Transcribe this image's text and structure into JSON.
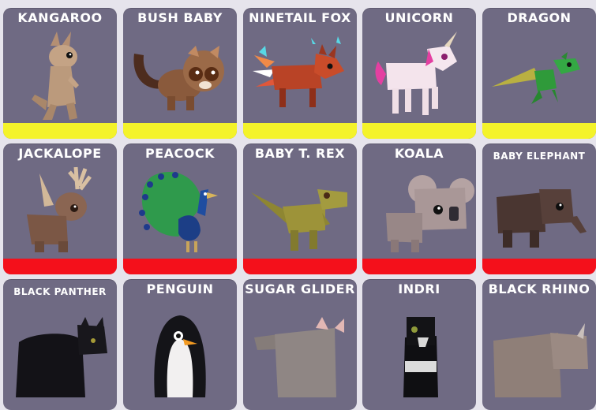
{
  "colors": {
    "card_bg": "#6f6a83",
    "rarity_yellow": "#f4f32a",
    "rarity_red": "#f4101b",
    "page_bg": "#e6e4ec"
  },
  "pets": [
    {
      "name": "KANGAROO",
      "icon": "kangaroo-icon",
      "rarity_color": "#f4f32a"
    },
    {
      "name": "BUSH BABY",
      "icon": "bush-baby-icon",
      "rarity_color": "#f4f32a"
    },
    {
      "name": "NINETAIL FOX",
      "icon": "ninetail-fox-icon",
      "rarity_color": "#f4f32a"
    },
    {
      "name": "UNICORN",
      "icon": "unicorn-icon",
      "rarity_color": "#f4f32a"
    },
    {
      "name": "DRAGON",
      "icon": "dragon-icon",
      "rarity_color": "#f4f32a"
    },
    {
      "name": "JACKALOPE",
      "icon": "jackalope-icon",
      "rarity_color": "#f4101b"
    },
    {
      "name": "PEACOCK",
      "icon": "peacock-icon",
      "rarity_color": "#f4101b"
    },
    {
      "name": "BABY T. REX",
      "icon": "baby-t-rex-icon",
      "rarity_color": "#f4101b"
    },
    {
      "name": "KOALA",
      "icon": "koala-icon",
      "rarity_color": "#f4101b"
    },
    {
      "name": "BABY ELEPHANT",
      "icon": "baby-elephant-icon",
      "rarity_color": "#f4101b"
    },
    {
      "name": "BLACK PANTHER",
      "icon": "black-panther-icon"
    },
    {
      "name": "PENGUIN",
      "icon": "penguin-icon"
    },
    {
      "name": "SUGAR GLIDER",
      "icon": "sugar-glider-icon"
    },
    {
      "name": "INDRI",
      "icon": "indri-icon"
    },
    {
      "name": "BLACK RHINO",
      "icon": "black-rhino-icon"
    }
  ]
}
